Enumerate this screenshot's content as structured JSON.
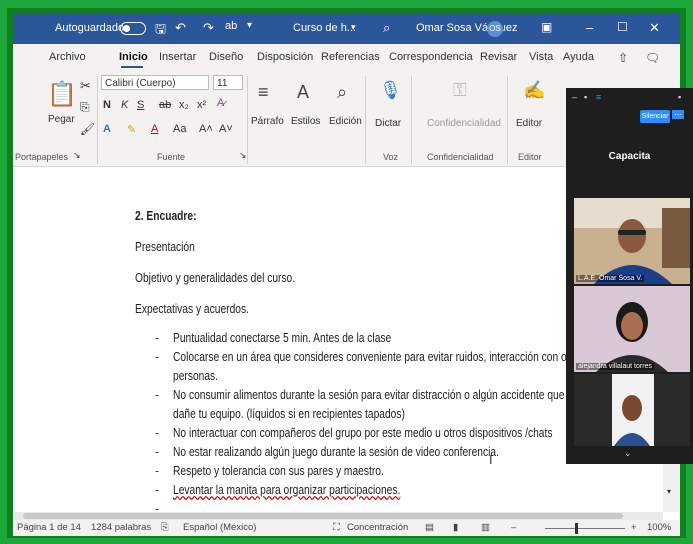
{
  "titlebar": {
    "autosave": "Autoguardado",
    "doc_name": "Curso de h...",
    "user": "Omar Sosa Vázquez",
    "initials": "OS"
  },
  "tabs": [
    "Archivo",
    "Inicio",
    "Insertar",
    "Diseño",
    "Disposición",
    "Referencias",
    "Correspondencia",
    "Revisar",
    "Vista",
    "Ayuda"
  ],
  "ribbon": {
    "paste": "Pegar",
    "font_name": "Calibri (Cuerpo)",
    "font_size": "11",
    "paragraph": "Párrafo",
    "styles": "Estilos",
    "editing": "Edición",
    "dictate": "Dictar",
    "confidentiality": "Confidencialidad",
    "editor": "Editor",
    "groups": {
      "clipboard": "Portapapeles",
      "font": "Fuente",
      "voice": "Voz",
      "confidentiality": "Confidencialidad",
      "editor": "Editor"
    }
  },
  "document": {
    "heading": "2. Encuadre:",
    "paragraphs": [
      "Presentación",
      "Objetivo y generalidades del curso.",
      "Expectativas y acuerdos."
    ],
    "bullets": [
      "Puntualidad conectarse 5 min. Antes de la clase",
      "Colocarse en un área que consideres conveniente para evitar ruidos, interacción con otras",
      "personas.",
      "No consumir alimentos durante la sesión para evitar distracción o algún accidente que",
      "dañe tu equipo. (líquidos si en recipientes tapados)",
      "No interactuar con compañeros del grupo por este medio u otros dispositivos /chats",
      "No estar realizando algún juego durante la sesión de video conferencia.",
      "Respeto y tolerancia con sus pares y maestro.",
      "Levantar la manita para organizar participaciones."
    ]
  },
  "status": {
    "page": "Página 1 de 14",
    "words": "1284 palabras",
    "language": "Español (México)",
    "focus": "Concentración",
    "zoom": "100%",
    "zoom_value": 1.0
  },
  "meeting": {
    "silence_btn": "Silenciar",
    "title": "Capacita",
    "participants": [
      "L.A.E. Omar Sosa V.",
      "alejandra villalaut torres"
    ]
  },
  "colors": {
    "word_blue": "#2b579a",
    "border_green": "#1fa83a",
    "zoom_blue": "#2d8cff"
  }
}
